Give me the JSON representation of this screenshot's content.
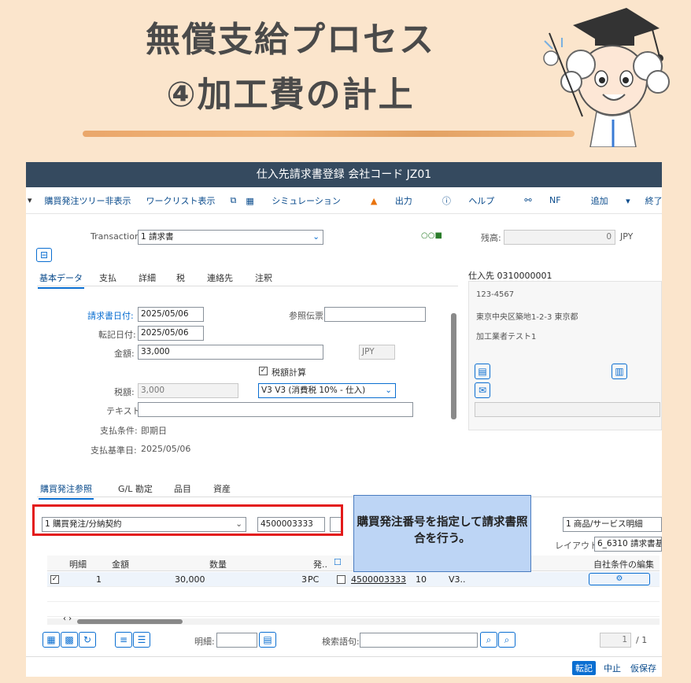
{
  "banner": {
    "title_line1": "無償支給プロセス",
    "title_line2": "④加工費の計上"
  },
  "window": {
    "title": "仕入先請求書登録 会社コード JZ01"
  },
  "toolbar": {
    "items": [
      "購買発注ツリー非表示",
      "ワークリスト表示",
      "シミュレーション",
      "出力",
      "ヘルプ",
      "NF",
      "追加"
    ],
    "exit": "終了"
  },
  "header": {
    "transaction_label": "Transaction",
    "transaction_value": "1 請求書",
    "balance_label": "残高:",
    "balance_value": "0",
    "balance_currency": "JPY"
  },
  "tabs": [
    "基本データ",
    "支払",
    "詳細",
    "税",
    "連絡先",
    "注釈"
  ],
  "basic": {
    "invoice_date_label": "請求書日付:",
    "invoice_date": "2025/05/06",
    "reference_label": "参照伝票",
    "reference_value": "",
    "posting_date_label": "転記日付:",
    "posting_date": "2025/05/06",
    "amount_label": "金額:",
    "amount": "33,000",
    "currency": "JPY",
    "calc_tax_label": "税額計算",
    "tax_label": "税額:",
    "tax_amount": "3,000",
    "tax_code": "V3 V3 (消費税 10% - 仕入)",
    "text_label": "テキスト:",
    "text_value": "",
    "payment_terms_label": "支払条件:",
    "payment_terms": "即期日",
    "baseline_label": "支払基準日:",
    "baseline_date": "2025/05/06"
  },
  "vendor": {
    "title": "仕入先 0310000001",
    "postal": "123-4567",
    "address": "東京中央区築地1-2-3 東京都",
    "name": "加工業者テスト1"
  },
  "po_tabs": [
    "購買発注参照",
    "G/L 勘定",
    "品目",
    "資産"
  ],
  "po_ref": {
    "type": "1 購買発注/分納契約",
    "po_number": "4500003333",
    "item_type": "1 商品/サービス明細",
    "layout_label": "レイアウト",
    "layout_value": "6_6310 請求書基",
    "callout": "購買発注番号を指定して請求書照合を行う。"
  },
  "grid": {
    "headers": [
      "明細",
      "金額",
      "数量",
      "発..",
      "自社条件の編集"
    ],
    "rows": [
      {
        "item": "1",
        "amount": "30,000",
        "qty": "3",
        "unit": "PC",
        "po": "4500003333",
        "po_item": "10",
        "tax": "V3.."
      }
    ]
  },
  "bottom": {
    "detail_label": "明細:",
    "search_label": "検索語句:",
    "page_current": "1",
    "page_total": "/ 1"
  },
  "footer": {
    "post": "転記",
    "cancel": "中止",
    "park": "仮保存"
  }
}
